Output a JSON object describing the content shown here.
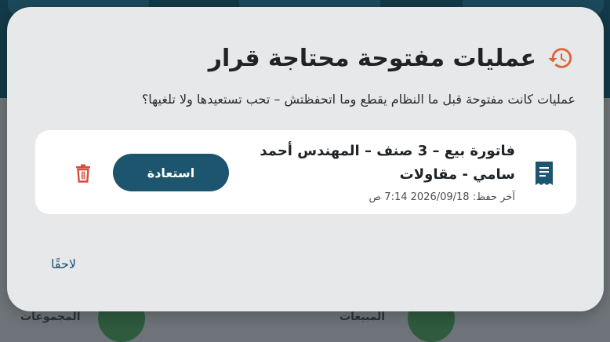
{
  "dialog": {
    "title": "عمليات مفتوحة محتاجة قرار",
    "subtitle": "عمليات كانت مفتوحة قبل ما النظام يقطع وما اتحفظتش – تحب تستعيدها ولا تلغيها؟",
    "later_label": "لاحقًا"
  },
  "operations": [
    {
      "title": "فاتورة بيع – 3 صنف – المهندس أحمد سامي - مقاولات",
      "last_saved": "آخر حفظ: 2026/09/18 7:14 ص",
      "restore_label": "استعادة"
    }
  ],
  "background": {
    "label_left": "المجموعات",
    "label_right": "المبيعات"
  },
  "colors": {
    "accent": "#1d556e",
    "history_icon": "#e0643a",
    "delete_icon": "#d84a3a"
  },
  "icons": {
    "title": "history-icon",
    "card": "receipt-icon",
    "delete": "trash-icon"
  }
}
